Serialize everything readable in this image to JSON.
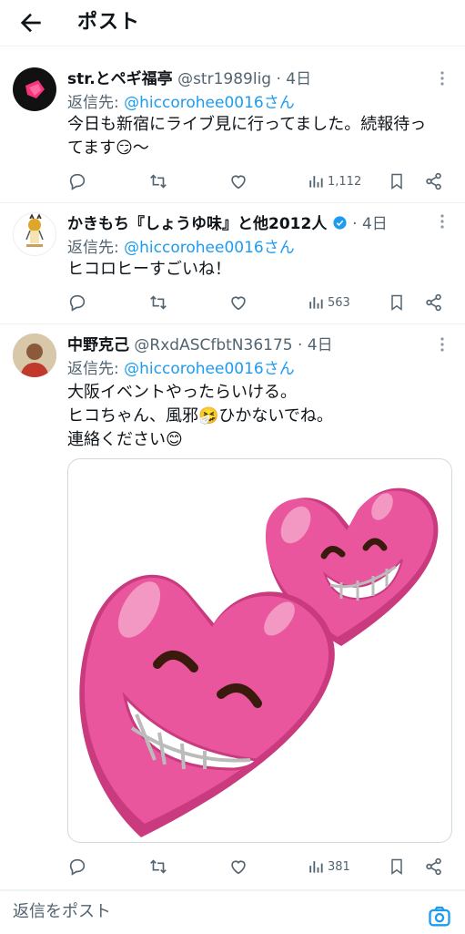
{
  "header": {
    "title": "ポスト"
  },
  "posts": [
    {
      "name": "str.とペギ福亭",
      "handle": "@str1989lig · 4日",
      "reply_prefix": "返信先: ",
      "reply_mention": "@hiccorohee0016さん",
      "lines": [
        "今日も新宿にライブ見に行ってました。続報待っ",
        "てます😏〜"
      ],
      "views": "1,112"
    },
    {
      "name": "かきもち『しょうゆ味』と他2012人",
      "handle": " · 4日",
      "reply_prefix": "返信先: ",
      "reply_mention": "@hiccorohee0016さん",
      "lines": [
        "ヒコロヒーすごいね！"
      ],
      "views": "563"
    },
    {
      "name": "中野克己",
      "handle": "@RxdASCfbtN36175 · 4日",
      "reply_prefix": "返信先: ",
      "reply_mention": "@hiccorohee0016さん",
      "lines": [
        "大阪イベントやったらいける。",
        "ヒコちゃん、風邪🤧ひかないでね。",
        "連絡ください😊"
      ],
      "views": "381",
      "media_icon": "two-grinning-pink-hearts"
    }
  ],
  "composer": {
    "placeholder": "返信をポスト"
  },
  "colors": {
    "accent": "#1d9bf0",
    "muted": "#536471",
    "heart": "#e84c9a"
  }
}
